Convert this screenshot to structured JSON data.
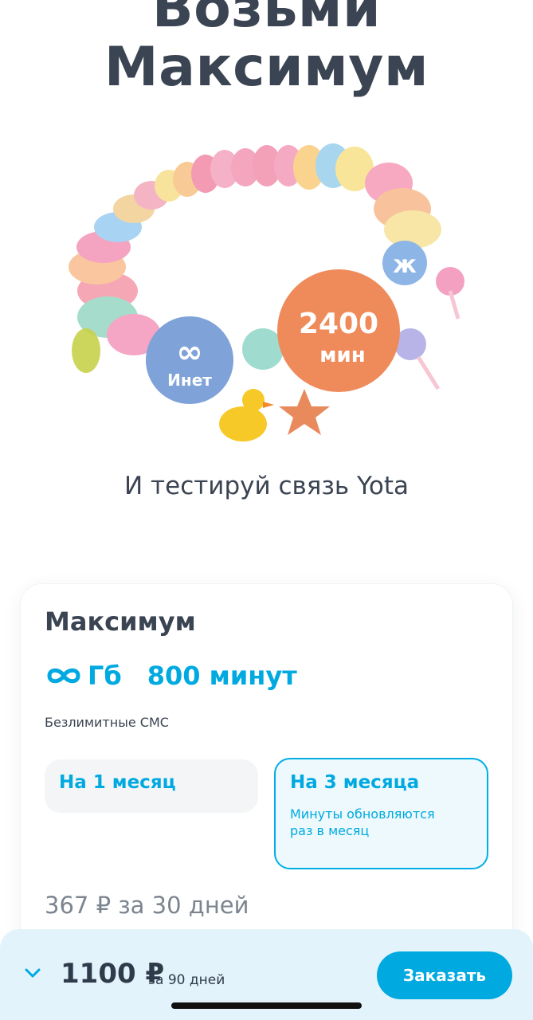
{
  "hero": {
    "title_line1": "Возьми",
    "title_line2": "Максимум",
    "subtitle": "И тестируй связь Yota"
  },
  "bracelet": {
    "internet_bead_label": "Инет",
    "minutes_bead_value": "2400",
    "minutes_bead_unit": "мин",
    "colors": {
      "blue_bead": "#7fa2d9",
      "orange_bead": "#ef8b5a",
      "star": "#e98a5c",
      "duck": "#f7c928"
    }
  },
  "plan": {
    "name": "Максимум",
    "internet": "Гб",
    "minutes": "800 минут",
    "sms": "Безлимитные СМС",
    "options": [
      {
        "label": "На 1 месяц",
        "selected": false
      },
      {
        "label": "На 3 месяца",
        "note": "Минуты обновляются раз в месяц",
        "selected": true
      }
    ],
    "price_line": "367 ₽  за 30 дней"
  },
  "bottom_bar": {
    "total": "1100 ₽",
    "period": "за 90 дней",
    "order_label": "Заказать"
  },
  "colors": {
    "accent": "#00a9e0",
    "text_dark": "#3b4452",
    "muted": "#7c858f",
    "bar_background": "#e2f3fb"
  },
  "icons": {
    "infinity": "infinity-icon",
    "chevron": "chevron-down-icon"
  }
}
